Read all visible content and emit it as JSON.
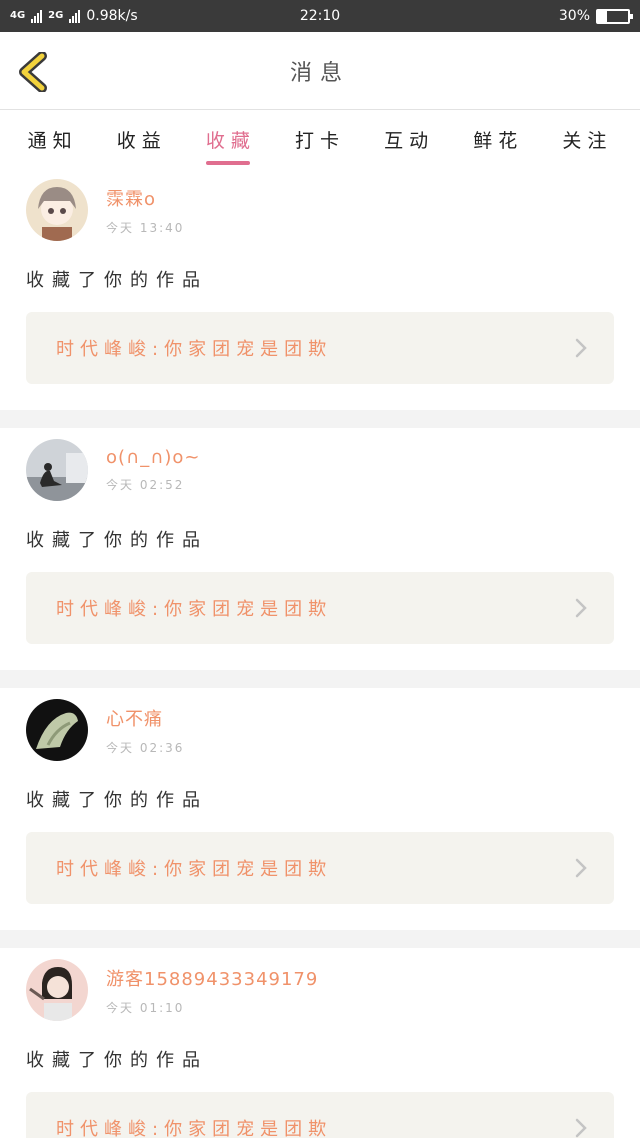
{
  "status_bar": {
    "net1": "4G",
    "net2": "2G",
    "speed": "0.98k/s",
    "time": "22:10",
    "battery_text": "30%",
    "battery_level": 0.3
  },
  "header": {
    "title": "消息",
    "back_icon": "chevron-left-icon"
  },
  "tabs": [
    {
      "label": "通知",
      "active": false
    },
    {
      "label": "收益",
      "active": false
    },
    {
      "label": "收藏",
      "active": true
    },
    {
      "label": "打卡",
      "active": false
    },
    {
      "label": "互动",
      "active": false
    },
    {
      "label": "鲜花",
      "active": false
    },
    {
      "label": "关注",
      "active": false
    }
  ],
  "messages": [
    {
      "user": "霂霖o",
      "time": "今天 13:40",
      "action": "收藏了你的作品",
      "work": "时代峰峻:你家团宠是团欺"
    },
    {
      "user": "o(∩_∩)o~",
      "time": "今天 02:52",
      "action": "收藏了你的作品",
      "work": "时代峰峻:你家团宠是团欺"
    },
    {
      "user": "心不痛",
      "time": "今天 02:36",
      "action": "收藏了你的作品",
      "work": "时代峰峻:你家团宠是团欺"
    },
    {
      "user": "游客15889433349179",
      "time": "今天 01:10",
      "action": "收藏了你的作品",
      "work": "时代峰峻:你家团宠是团欺"
    }
  ],
  "colors": {
    "accent": "#e06e8f",
    "name": "#f0926a",
    "statusbar": "#3a3a3a"
  }
}
